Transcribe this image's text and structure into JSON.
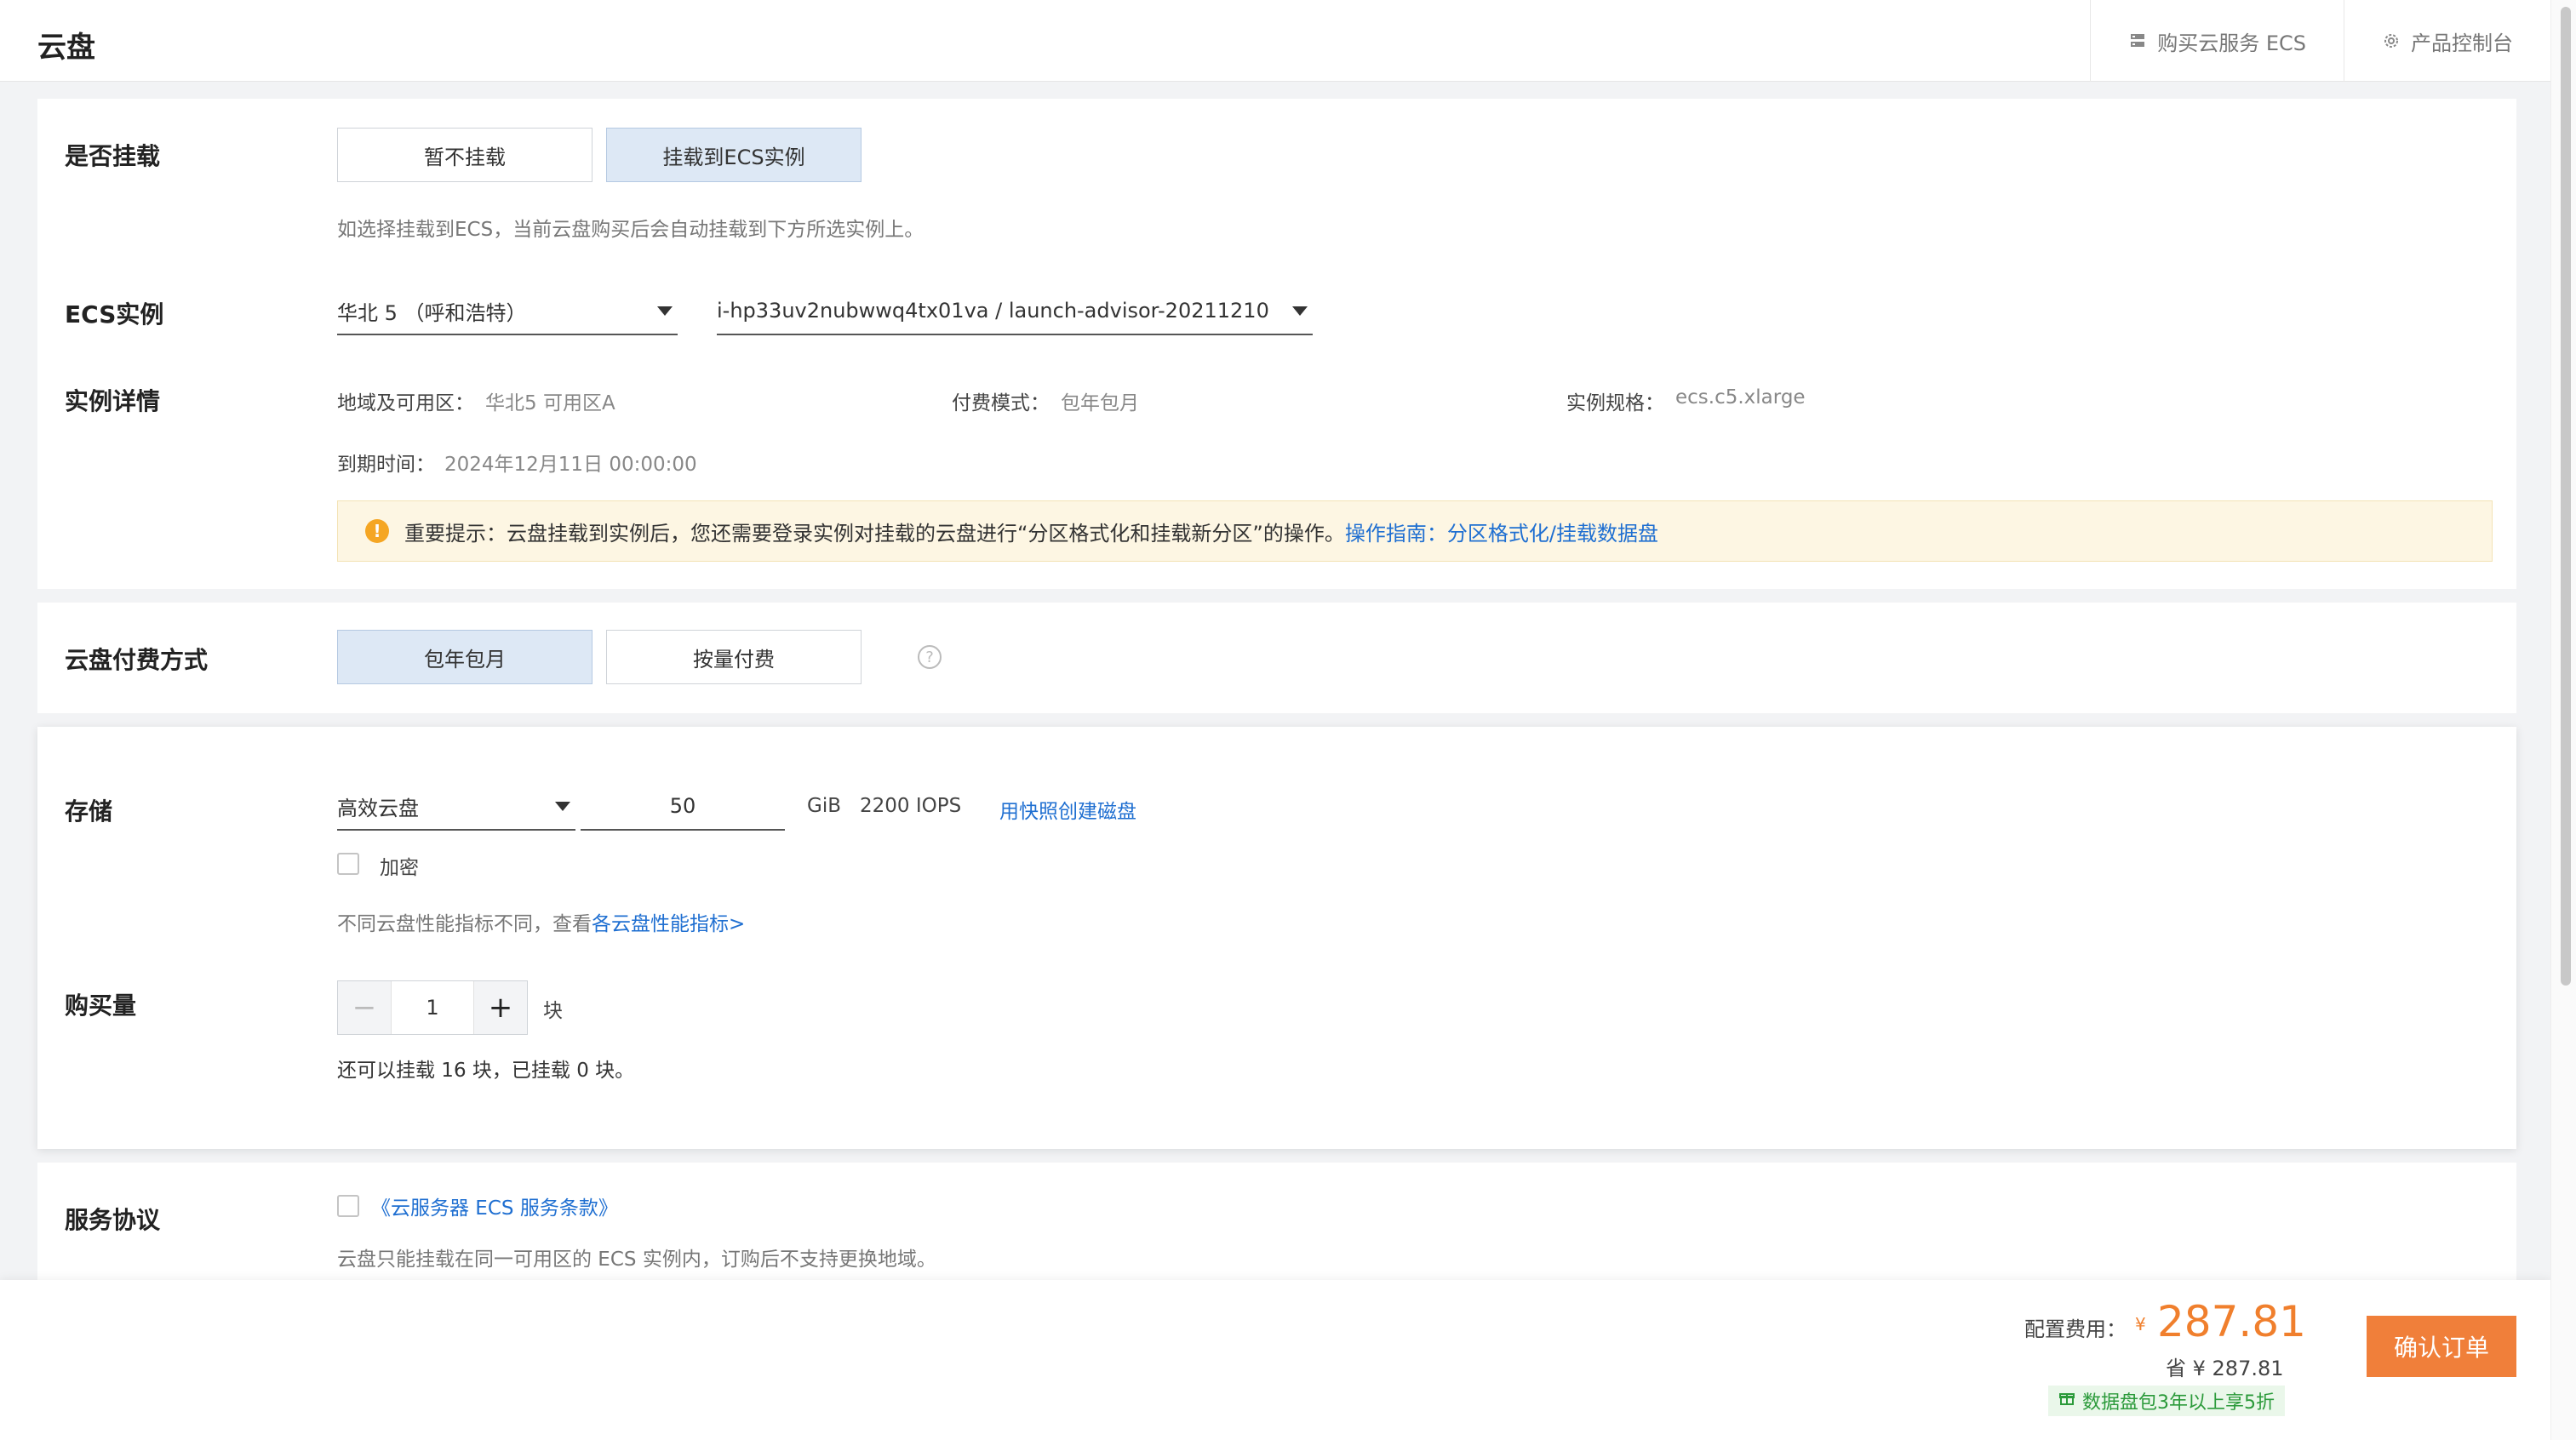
{
  "header": {
    "title": "云盘",
    "actions": [
      {
        "icon": "server-icon",
        "label": "购买云服务 ECS"
      },
      {
        "icon": "gear-icon",
        "label": "产品控制台"
      }
    ]
  },
  "mount": {
    "label": "是否挂载",
    "options": [
      "暂不挂载",
      "挂载到ECS实例"
    ],
    "selected": "挂载到ECS实例",
    "hint": "如选择挂载到ECS，当前云盘购买后会自动挂载到下方所选实例上。"
  },
  "ecs": {
    "label": "ECS实例",
    "region": "华北 5 （呼和浩特）",
    "instance": "i-hp33uv2nubwwq4tx01va / launch-advisor-20211210"
  },
  "details": {
    "label": "实例详情",
    "zone_key": "地域及可用区：",
    "zone_val": "华北5 可用区A",
    "billing_key": "付费模式：",
    "billing_val": "包年包月",
    "spec_key": "实例规格：",
    "spec_val": "ecs.c5.xlarge",
    "expire_key": "到期时间：",
    "expire_val": "2024年12月11日 00:00:00",
    "notice_text": "重要提示：云盘挂载到实例后，您还需要登录实例对挂载的云盘进行“分区格式化和挂载新分区”的操作。",
    "notice_link": "操作指南：分区格式化/挂载数据盘"
  },
  "payment": {
    "label": "云盘付费方式",
    "options": [
      "包年包月",
      "按量付费"
    ],
    "selected": "包年包月",
    "help": "?"
  },
  "storage": {
    "label": "存储",
    "disk_type": "高效云盘",
    "size": "50",
    "unit": "GiB",
    "iops": "2200 IOPS",
    "snapshot_link": "用快照创建磁盘",
    "encrypt_label": "加密",
    "encrypt_checked": false,
    "perf_hint": "不同云盘性能指标不同，查看",
    "perf_link": "各云盘性能指标>"
  },
  "quantity": {
    "label": "购买量",
    "minus": "−",
    "value": "1",
    "plus": "+",
    "unit": "块",
    "hint": "还可以挂载 16 块，已挂载 0 块。"
  },
  "agreement": {
    "label": "服务协议",
    "link": "《云服务器 ECS 服务条款》",
    "checked": false,
    "note": "云盘只能挂载在同一可用区的 ECS 实例内，订购后不支持更换地域。"
  },
  "footer": {
    "fee_label": "配置费用：",
    "currency": "¥",
    "fee_value": "287.81",
    "save_label": "省",
    "save_value": "¥ 287.81",
    "promo": "数据盘包3年以上享5折",
    "confirm": "确认订单"
  },
  "colors": {
    "accent": "#f07f3a",
    "link": "#1f6fd1",
    "selected_bg": "#dde8f5",
    "notice_bg": "#fdf6e3",
    "promo_green": "#2b9a3a"
  }
}
